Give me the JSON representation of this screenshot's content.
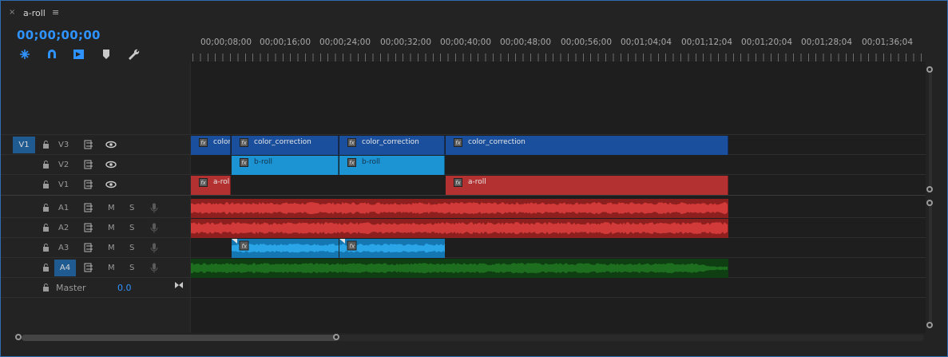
{
  "tab": {
    "close": "×",
    "title": "a-roll",
    "menu": "≡"
  },
  "timecode": "00;00;00;00",
  "tools": [
    "snap-in-sequence-icon",
    "magnet-linked-selection-icon",
    "insert-overwrite-icon",
    "marker-icon",
    "wrench-icon"
  ],
  "ruler": {
    "labels": [
      "00;00;08;00",
      "00;00;16;00",
      "00;00;24;00",
      "00;00;32;00",
      "00;00;40;00",
      "00;00;48;00",
      "00;00;56;00",
      "00;01;04;04",
      "00;01;12;04",
      "00;01;20;04",
      "00;01;28;04",
      "00;01;36;04"
    ]
  },
  "tracks": {
    "v3": {
      "source": "V1",
      "name": "V3"
    },
    "v2": {
      "name": "V2"
    },
    "v1": {
      "name": "V1"
    },
    "a1": {
      "name": "A1",
      "m": "M",
      "s": "S"
    },
    "a2": {
      "name": "A2",
      "m": "M",
      "s": "S"
    },
    "a3": {
      "name": "A3",
      "m": "M",
      "s": "S"
    },
    "a4": {
      "name": "A4",
      "m": "M",
      "s": "S"
    },
    "master": {
      "name": "Master",
      "value": "0.0"
    }
  },
  "clips": {
    "v3": [
      "color_",
      "color_correction",
      "color_correction",
      "color_correction"
    ],
    "v2": [
      "b-roll",
      "b-roll"
    ],
    "v1": [
      "a-roll",
      "a-roll"
    ]
  },
  "colors": {
    "accent": "#2f93ff",
    "video_adjust": "#1a4f9e",
    "broll": "#1c93d3",
    "aroll": "#b43131",
    "audio_a4": "#1d5e1d"
  }
}
